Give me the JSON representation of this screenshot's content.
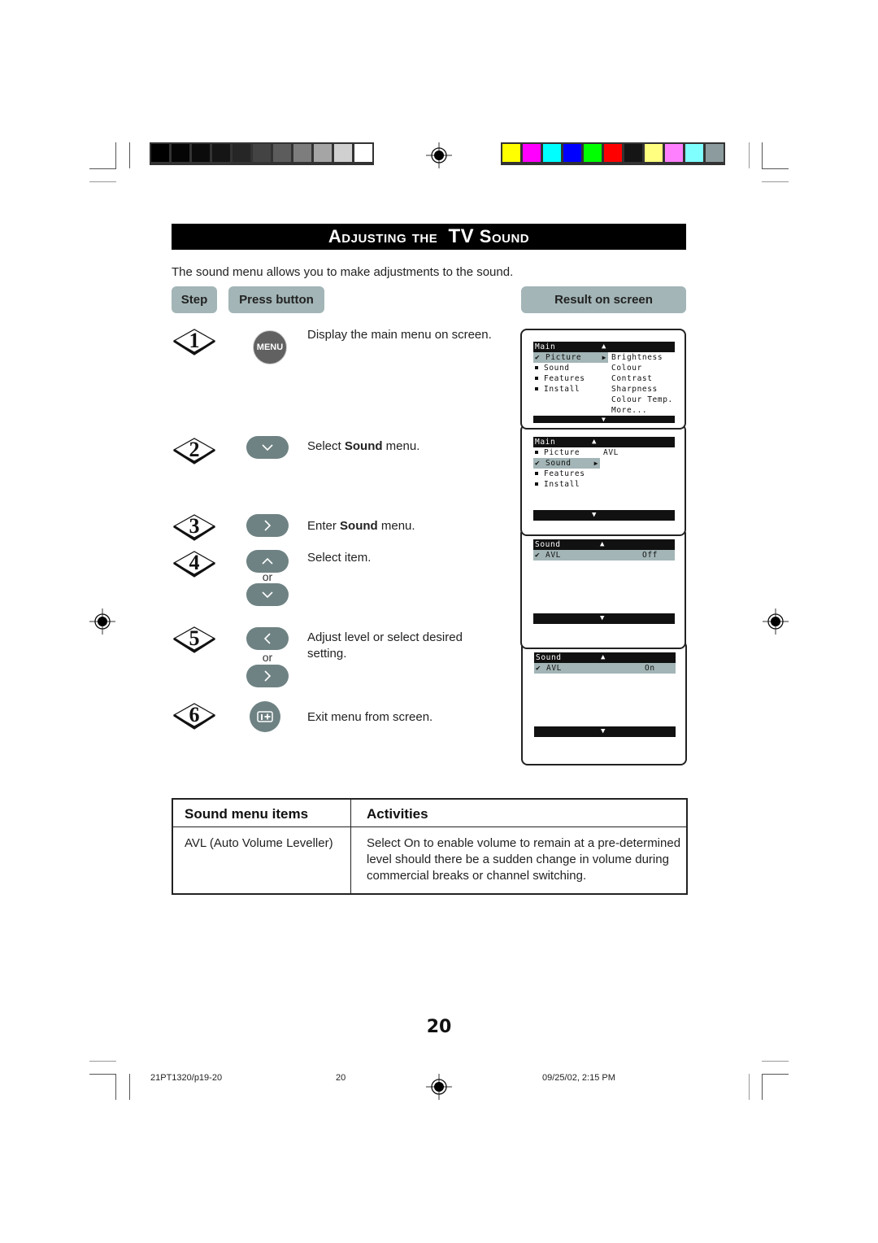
{
  "color_bars": {
    "grayscale": [
      "#000000",
      "#050505",
      "#0b0b0b",
      "#151515",
      "#262626",
      "#434343",
      "#5c5c5c",
      "#7d7d7d",
      "#a5a5a5",
      "#d0d0d0",
      "#ffffff"
    ],
    "colors": [
      "#ffff00",
      "#ff00ff",
      "#00ffff",
      "#0000ff",
      "#00ff00",
      "#ff0000",
      "#151515",
      "#ffff80",
      "#ff80ff",
      "#80ffff",
      "#8c9c9e"
    ]
  },
  "title": {
    "part1": "Adjusting the",
    "part2": "TV",
    "part3": "Sound"
  },
  "intro": "The sound menu allows you to make adjustments to the sound.",
  "headers": {
    "step": "Step",
    "press": "Press button",
    "result": "Result on screen"
  },
  "steps": [
    {
      "num": "1",
      "button": "MENU",
      "desc": "Display the main menu on screen."
    },
    {
      "num": "2",
      "desc_pre": "Select ",
      "desc_bold": "Sound",
      "desc_post": " menu."
    },
    {
      "num": "3",
      "desc_pre": "Enter ",
      "desc_bold": "Sound",
      "desc_post": " menu."
    },
    {
      "num": "4",
      "or": "or",
      "desc": "Select item."
    },
    {
      "num": "5",
      "or": "or",
      "desc_line1": "Adjust level or select desired",
      "desc_line2": "setting."
    },
    {
      "num": "6",
      "desc": "Exit menu from screen."
    }
  ],
  "screens": [
    {
      "header": "Main",
      "items": [
        "Picture",
        "Sound",
        "Features",
        "Install"
      ],
      "selected": 0,
      "submenu": [
        "Brightness",
        "Colour",
        "Contrast",
        "Sharpness",
        "Colour Temp.",
        "More..."
      ]
    },
    {
      "header": "Main",
      "items": [
        "Picture",
        "Sound",
        "Features",
        "Install"
      ],
      "selected": 1,
      "submenu": [
        "AVL"
      ]
    },
    {
      "header": "Sound",
      "item": "AVL",
      "value": "Off"
    },
    {
      "header": "Sound",
      "item": "AVL",
      "value": "On"
    }
  ],
  "glyphs": {
    "check": "✔",
    "up": "▲",
    "down": "▼",
    "right": "▶"
  },
  "table": {
    "col1": "Sound menu items",
    "col2": "Activities",
    "rows": [
      {
        "item": "AVL (Auto Volume Leveller)",
        "activity_lines": [
          "Select On to enable volume to remain at a pre-determined",
          "level should there be a sudden change in volume during",
          "commercial breaks or channel switching."
        ]
      }
    ]
  },
  "page_number": "20",
  "footer": {
    "file": "21PT1320/p19-20",
    "page": "20",
    "timestamp": "09/25/02, 2:15 PM"
  }
}
